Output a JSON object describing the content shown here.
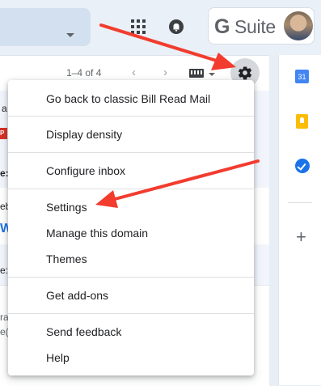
{
  "header": {
    "brand_g": "G",
    "brand_suite": "Suite"
  },
  "toolbar": {
    "page_count": "1–4 of 4",
    "prev_label": "‹",
    "next_label": "›"
  },
  "email_peek": {
    "row1": "a",
    "row2": "P",
    "row3": "e:",
    "row4a": "eb",
    "row4b": "W",
    "row5": "e:",
    "row6a": "ra",
    "row6b": "e("
  },
  "side_panel": {
    "calendar_day": "31",
    "add_label": "+"
  },
  "menu": {
    "items": [
      {
        "label": "Go back to classic Bill Read Mail"
      },
      {
        "label": "Display density"
      },
      {
        "label": "Configure inbox"
      },
      {
        "label": "Settings"
      },
      {
        "label": "Manage this domain"
      },
      {
        "label": "Themes"
      },
      {
        "label": "Get add-ons"
      },
      {
        "label": "Send feedback"
      },
      {
        "label": "Help"
      }
    ]
  },
  "colors": {
    "arrow": "#f23c2e",
    "accent": "#1a73e8"
  }
}
